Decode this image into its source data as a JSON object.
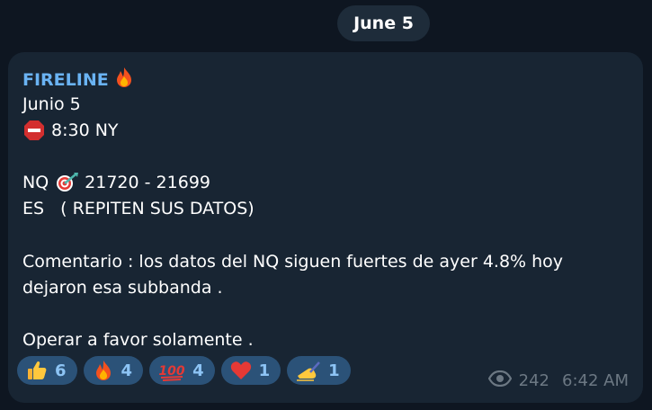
{
  "date_divider": "June 5",
  "message": {
    "sender": "FIRELINE",
    "sender_icon": "fire-icon",
    "lines": [
      "Junio 5",
      "8:30 NY",
      "NQ",
      "21720 - 21699",
      "ES   ( REPITEN SUS DATOS)",
      "Comentario : los datos del NQ siguen fuertes de ayer 4.8% hoy",
      "dejaron esa subbanda .",
      "Operar a favor solamente ."
    ],
    "icons": {
      "stop": "stop-sign-icon",
      "target": "bullseye-icon"
    }
  },
  "reactions": [
    {
      "icon": "thumbs-up-icon",
      "count": "6"
    },
    {
      "icon": "fire-icon",
      "count": "4"
    },
    {
      "icon": "hundred-points-icon",
      "count": "4"
    },
    {
      "icon": "red-heart-icon",
      "count": "1"
    },
    {
      "icon": "writing-hand-icon",
      "count": "1"
    }
  ],
  "footer": {
    "views": "242",
    "time": "6:42 AM"
  },
  "colors": {
    "background": "#0e1621",
    "bubble": "#182533",
    "sender": "#6ab3f3",
    "reaction_bg": "#2b5278",
    "reaction_text": "#8dc4f5",
    "meta": "#6c7883"
  }
}
